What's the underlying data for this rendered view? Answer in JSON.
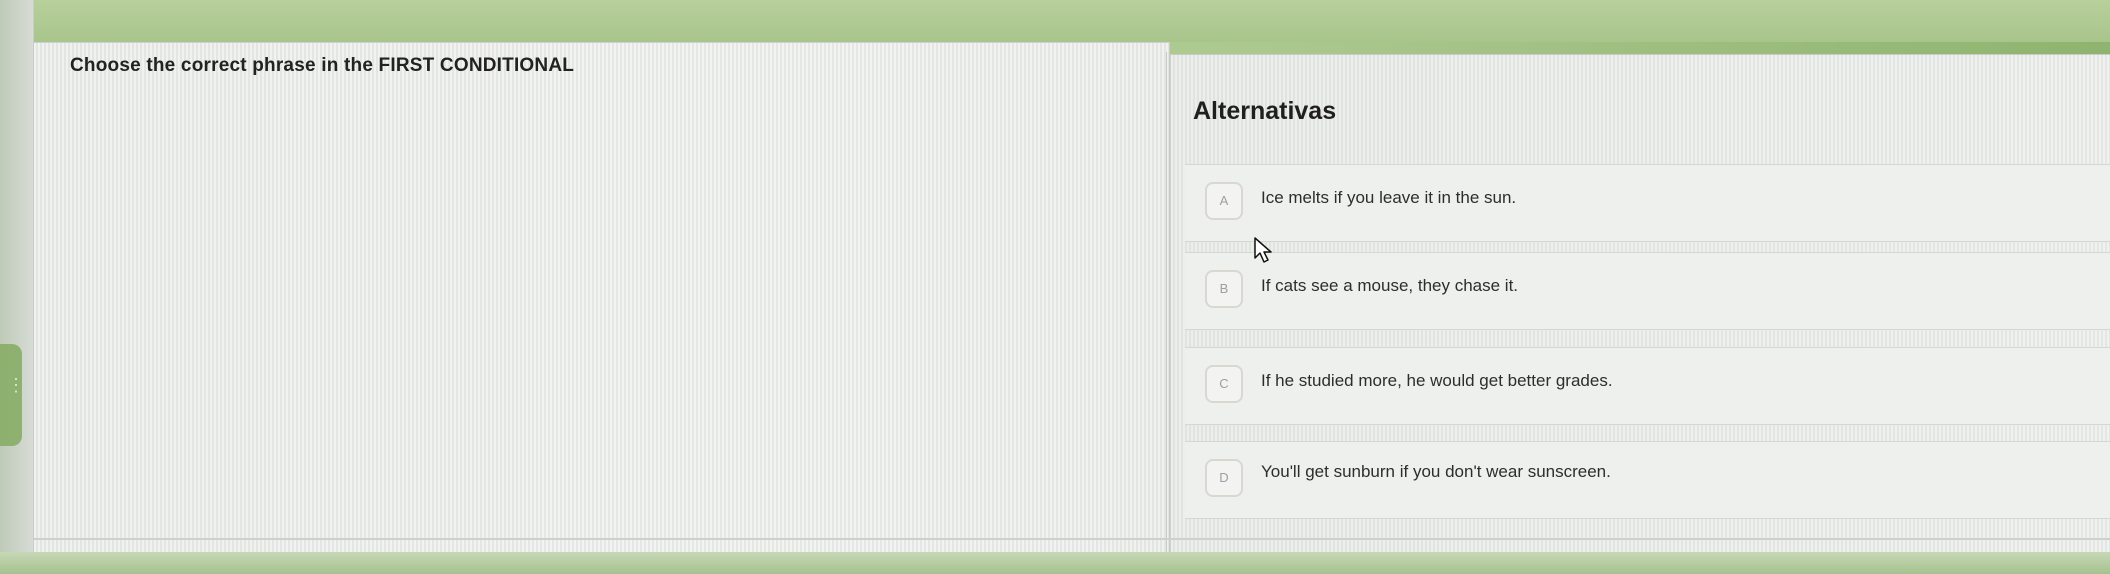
{
  "question": {
    "prompt": "Choose the correct phrase in the FIRST CONDITIONAL"
  },
  "alternatives": {
    "title": "Alternativas",
    "options": [
      {
        "letter": "A",
        "text": "Ice melts if you leave it in the sun."
      },
      {
        "letter": "B",
        "text": "If cats see a mouse, they chase it."
      },
      {
        "letter": "C",
        "text": "If he studied more, he would get better grades."
      },
      {
        "letter": "D",
        "text": "You'll get sunburn if you don't wear sunscreen."
      }
    ]
  },
  "icons": {
    "pointer": "mouse-pointer-icon",
    "drag_handle": "drag-handle-icon"
  },
  "colors": {
    "background_green": "#a9c98a",
    "panel": "#e7e9e6",
    "option_background": "#eef0ee",
    "letter_border": "#d9d7cf",
    "text": "#222222"
  }
}
